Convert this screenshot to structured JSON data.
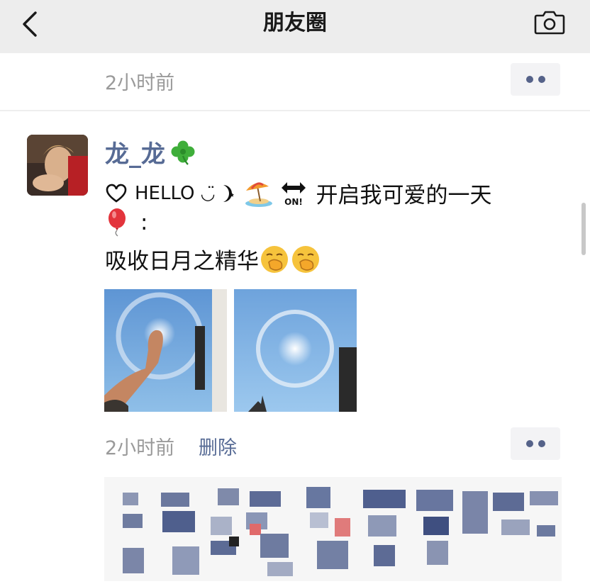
{
  "nav": {
    "title": "朋友圈"
  },
  "previous_post": {
    "time": "2小时前"
  },
  "post": {
    "author": "龙_龙",
    "hello": "HELLO",
    "text_line1_tail": "开启我可爱的一天",
    "text_line2_tail": ":",
    "text_line3": "吸收日月之精华",
    "time": "2小时前",
    "delete_label": "删除"
  },
  "colors": {
    "nav_background": "#ededed",
    "link": "#576b95",
    "muted_text": "#9a9a9a"
  },
  "icons": [
    "back-icon",
    "camera-icon",
    "more-icon",
    "clover-icon",
    "heart-icon",
    "moon-icon",
    "beach-umbrella-icon",
    "on-arrow-icon",
    "balloon-icon",
    "hand-over-mouth-icon"
  ]
}
